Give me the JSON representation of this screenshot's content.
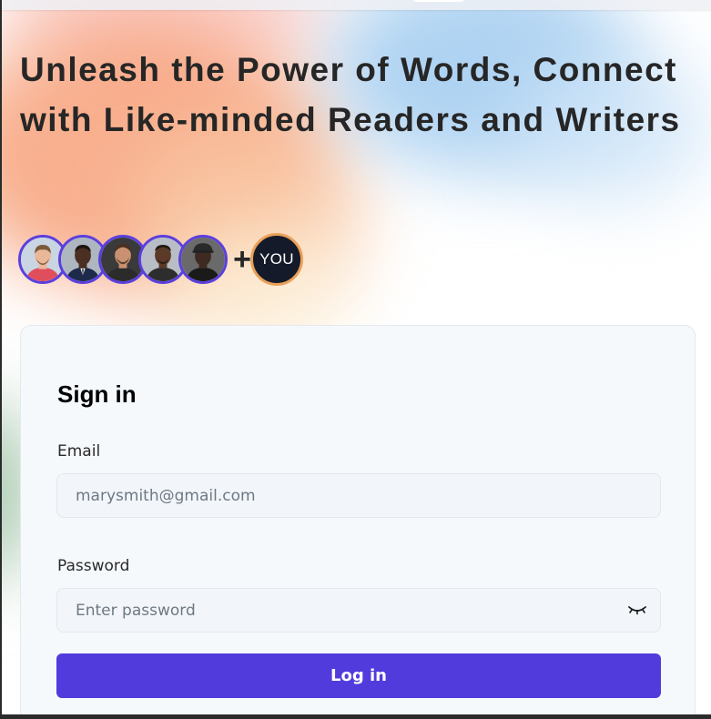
{
  "hero": {
    "headline": "Unleash the Power of Words, Connect with Like-minded Readers and Writers"
  },
  "community": {
    "avatars": [
      {
        "icon": "person-avatar-icon",
        "skin": "#e9b89b",
        "hair": "#7a5a3a",
        "shirt": "#e04e5c",
        "bg": "#c9d5e2"
      },
      {
        "icon": "person-avatar-icon",
        "skin": "#4b2f22",
        "hair": "#1d1510",
        "shirt": "#1d2a4a",
        "bg": "#aeb6c0"
      },
      {
        "icon": "person-avatar-icon",
        "skin": "#c99172",
        "hair": "#4a3020",
        "shirt": "#2b2b2b",
        "bg": "#3a3a3a"
      },
      {
        "icon": "person-avatar-icon",
        "skin": "#5b3a28",
        "hair": "#1f1712",
        "shirt": "#2d2d2d",
        "bg": "#b9bec6"
      },
      {
        "icon": "person-avatar-icon",
        "skin": "#3e2a20",
        "hair": "#2a2a2a",
        "shirt": "#1a1a1a",
        "bg": "#6a6a6a"
      }
    ],
    "plus": "+",
    "you_label": "YOU"
  },
  "signin": {
    "title": "Sign in",
    "email_label": "Email",
    "email_placeholder": "marysmith@gmail.com",
    "password_label": "Password",
    "password_placeholder": "Enter password",
    "password_toggle_icon": "eye-closed-icon",
    "login_label": "Log in"
  },
  "colors": {
    "accent": "#523bdc",
    "avatar_border": "#5b3fdd",
    "you_border": "#e9a15a",
    "you_bg": "#151a2a",
    "card_bg": "#f5f9fc"
  }
}
